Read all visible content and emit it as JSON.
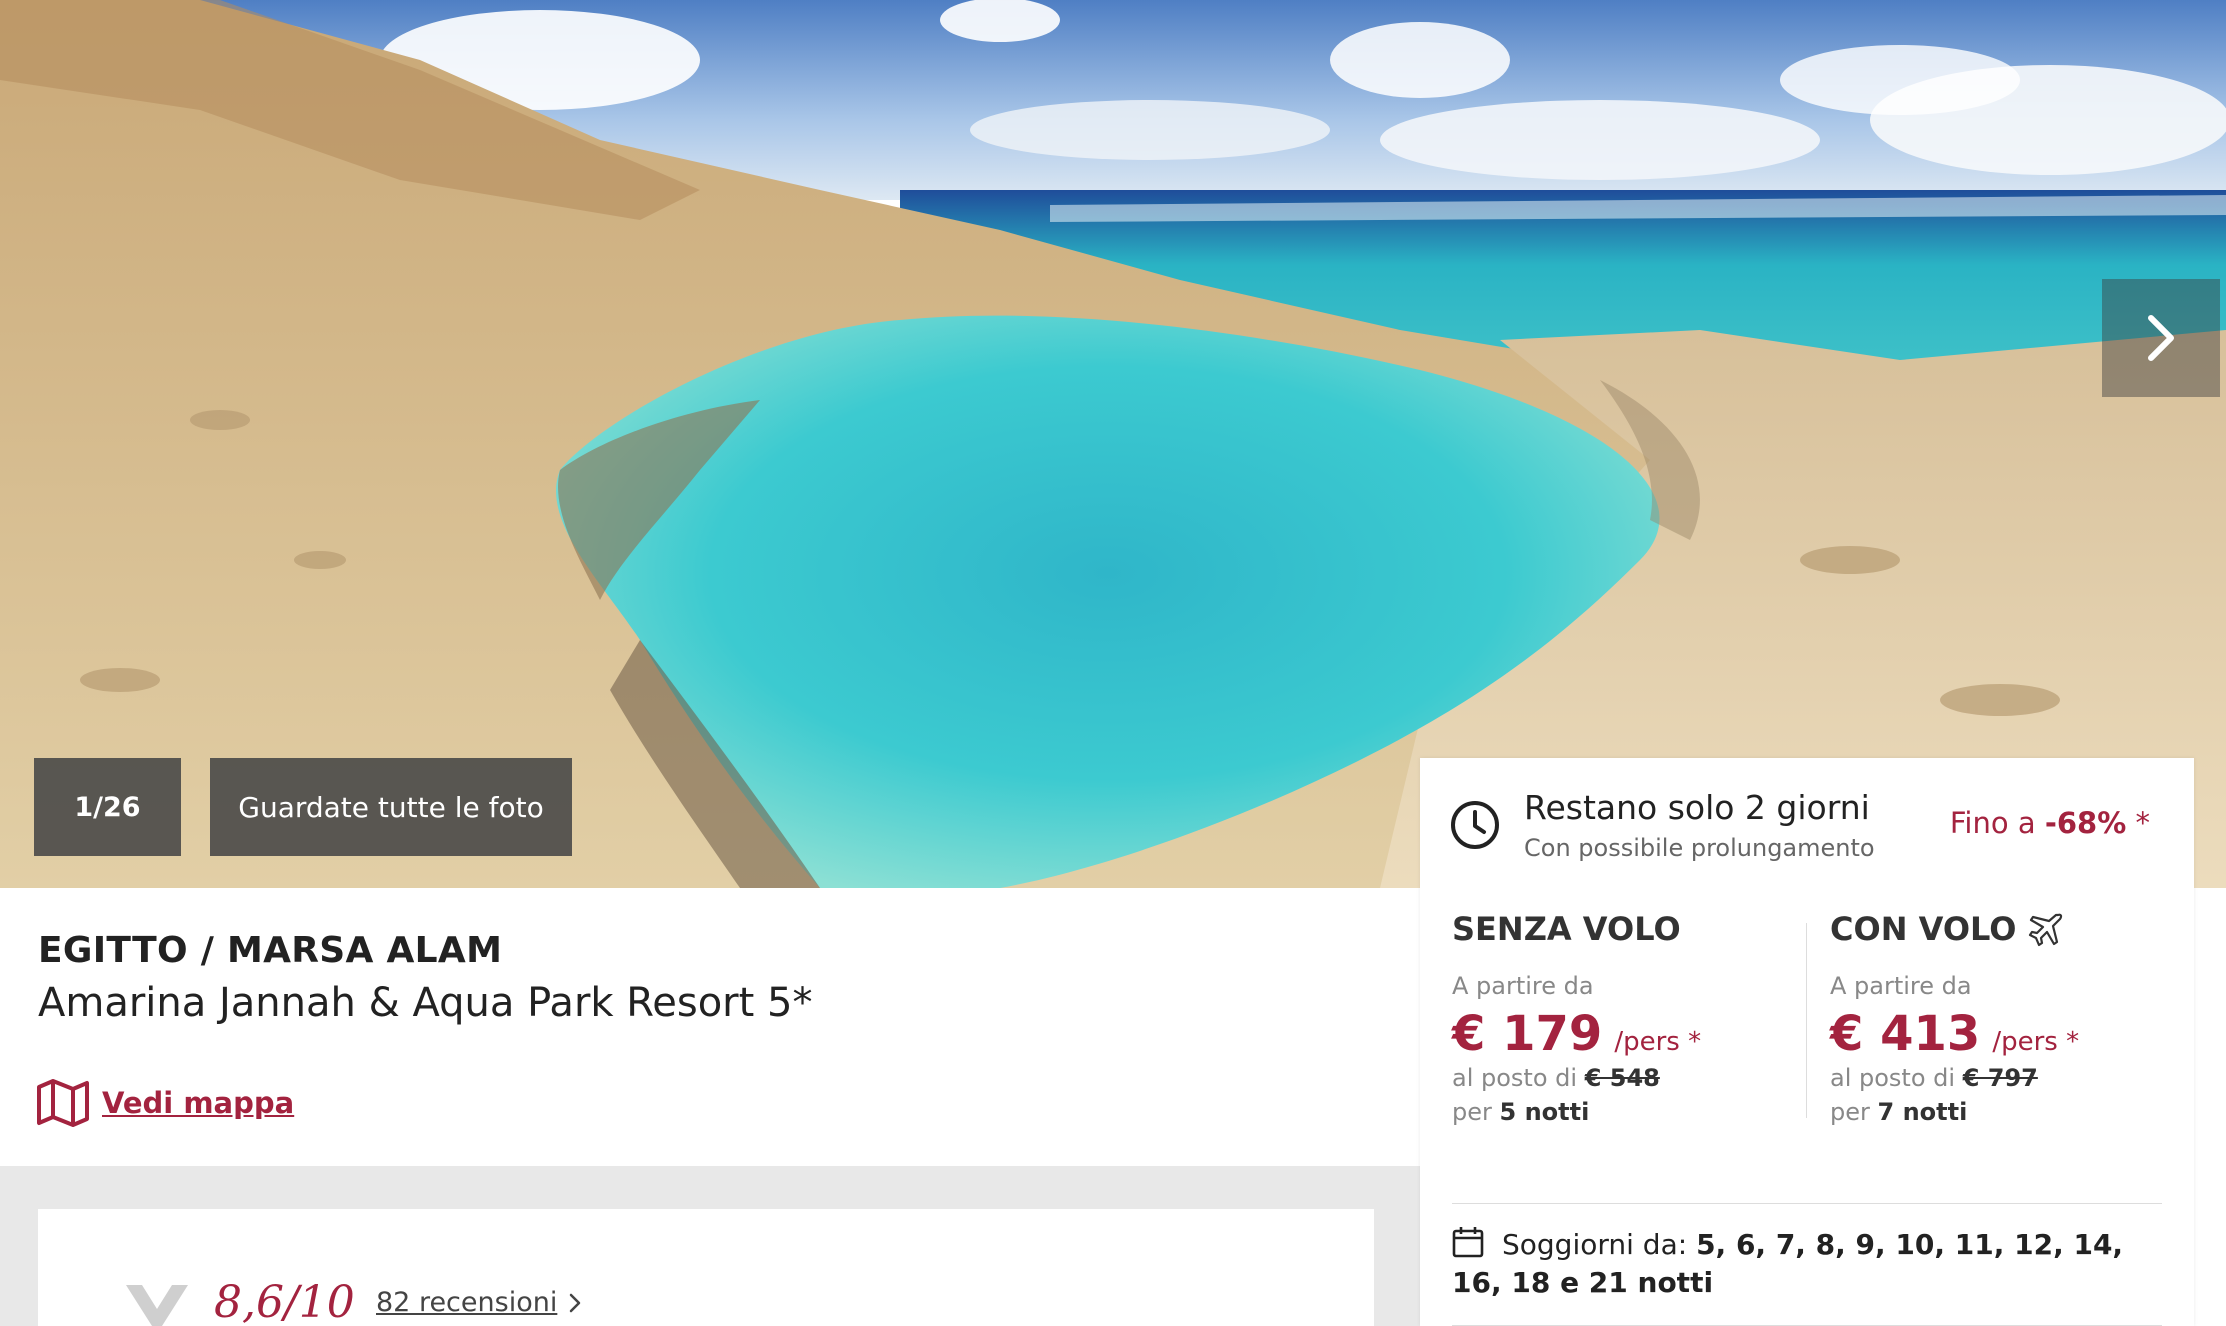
{
  "hero": {
    "photo_counter": "1/26",
    "all_photos_label": "Guardate tutte le foto",
    "next_icon": "chevron-right-icon"
  },
  "hotel": {
    "destination": "EGITTO / MARSA ALAM",
    "name": "Amarina Jannah & Aqua Park Resort 5*",
    "map_link": "Vedi mappa",
    "map_icon": "map-icon"
  },
  "reviews": {
    "score": "8,6/10",
    "count_label": "82 recensioni",
    "logo_icon": "reviews-logo-icon",
    "chevron_icon": "chevron-right-icon"
  },
  "offer": {
    "urgency_title": "Restano solo 2 giorni",
    "urgency_subtitle": "Con possibile prolungamento",
    "discount_prefix": "Fino a",
    "discount_value": "-68%",
    "discount_suffix": "*",
    "clock_icon": "clock-icon"
  },
  "pricing": {
    "without_flight": {
      "heading": "SENZA VOLO",
      "from_label": "A partire da",
      "price": "€ 179",
      "per": "/pers *",
      "instead_label": "al posto di",
      "old_price": "€ 548",
      "for_label": "per",
      "nights": "5 notti"
    },
    "with_flight": {
      "heading": "CON VOLO",
      "icon": "plane-icon",
      "from_label": "A partire da",
      "price": "€ 413",
      "per": "/pers *",
      "instead_label": "al posto di",
      "old_price": "€ 797",
      "for_label": "per",
      "nights": "7 notti"
    }
  },
  "stays": {
    "label": "Soggiorni da:",
    "values": "5, 6, 7, 8, 9, 10, 11, 12, 14, 16, 18 e 21 notti",
    "calendar_icon": "calendar-icon"
  },
  "colors": {
    "accent": "#a3233f",
    "overlay": "#464646",
    "grey_band": "#e8e8e8"
  }
}
